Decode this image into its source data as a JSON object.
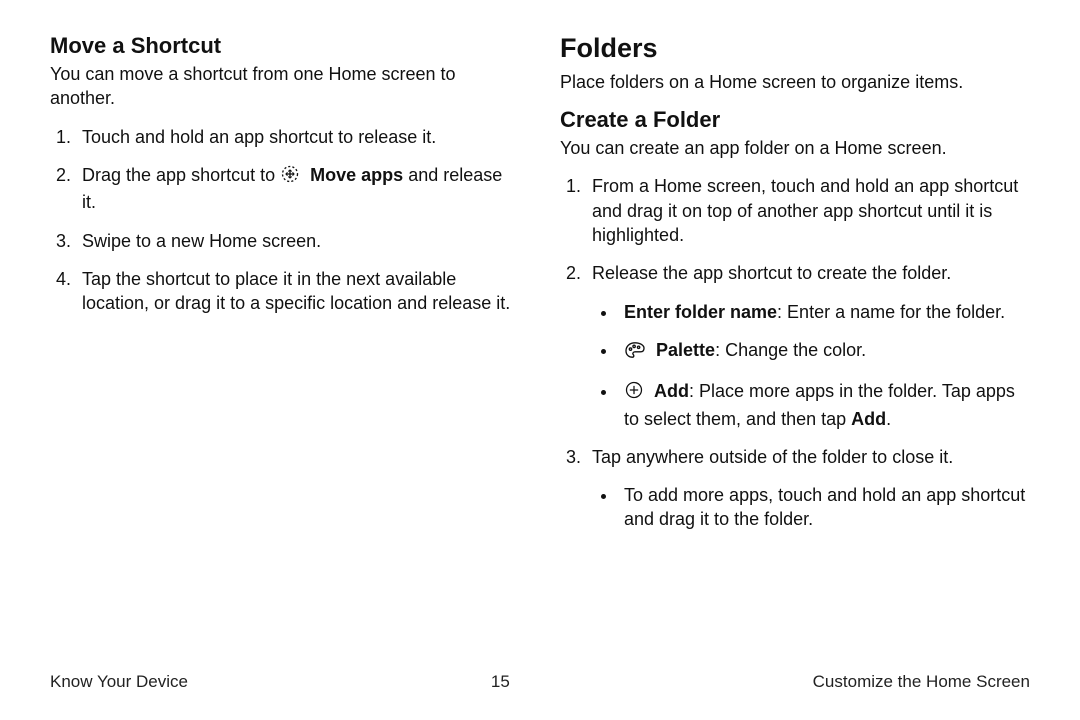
{
  "left": {
    "heading_move": "Move a Shortcut",
    "intro_move": "You can move a shortcut from one Home screen to another.",
    "steps_move": {
      "s1": "Touch and hold an app shortcut to release it.",
      "s2a": "Drag the app shortcut to ",
      "s2_icon_label": "Move apps",
      "s2b": " and release it.",
      "s3": "Swipe to a new Home screen.",
      "s4": "Tap the shortcut to place it in the next available location, or drag it to a specific location and release it."
    }
  },
  "right": {
    "heading_folders": "Folders",
    "intro_folders": "Place folders on a Home screen to organize items.",
    "heading_create": "Create a Folder",
    "intro_create": "You can create an app folder on a Home screen.",
    "steps_create": {
      "s1": "From a Home screen, touch and hold an app shortcut and drag it on top of another app shortcut until it is highlighted.",
      "s2": "Release the app shortcut to create the folder.",
      "b1_label": "Enter folder name",
      "b1_rest": ": Enter a name for the folder.",
      "b2_label": "Palette",
      "b2_rest": ": Change the color.",
      "b3_label": "Add",
      "b3_mid": ": Place more apps in the folder. Tap apps to select them, and then tap ",
      "b3_tail_bold": "Add",
      "b3_tail_end": ".",
      "s3": "Tap anywhere outside of the folder to close it.",
      "s3_sub": "To add more apps, touch and hold an app shortcut and drag it to the folder."
    }
  },
  "footer": {
    "left": "Know Your Device",
    "page": "15",
    "right": "Customize the Home Screen"
  }
}
